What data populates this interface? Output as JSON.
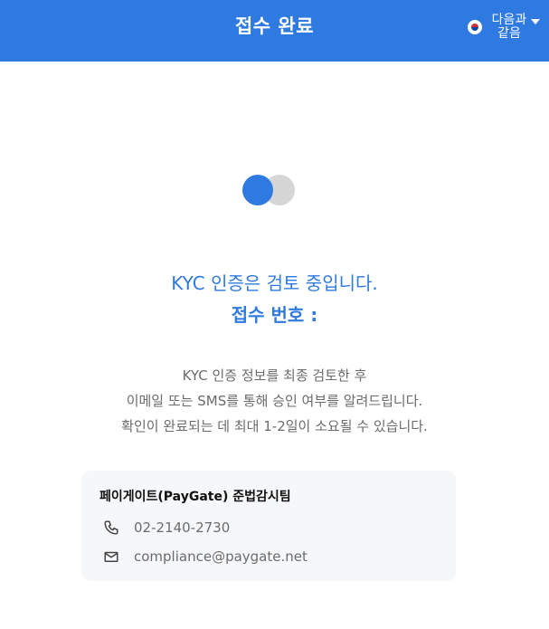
{
  "header": {
    "title": "접수 완료",
    "language": {
      "flag_icon": "korea-flag-icon",
      "label": "다음과 같음",
      "caret_icon": "caret-down-icon"
    }
  },
  "status": {
    "message": "KYC 인증은 검토 중입니다.",
    "receipt_label": "접수 번호 :"
  },
  "description": [
    "KYC 인증 정보를 최종 검토한 후",
    "이메일 또는 SMS를 통해 승인 여부를 알려드립니다.",
    "확인이 완료되는 데 최대 1-2일이 소요될 수 있습니다."
  ],
  "contact": {
    "title": "페이게이트(PayGate) 준법감시팀",
    "phone": "02-2140-2730",
    "email": "compliance@paygate.net"
  },
  "colors": {
    "accent": "#2f7ae0",
    "loader_grey": "#d6d6d6",
    "card_bg": "#f6f7f9"
  }
}
